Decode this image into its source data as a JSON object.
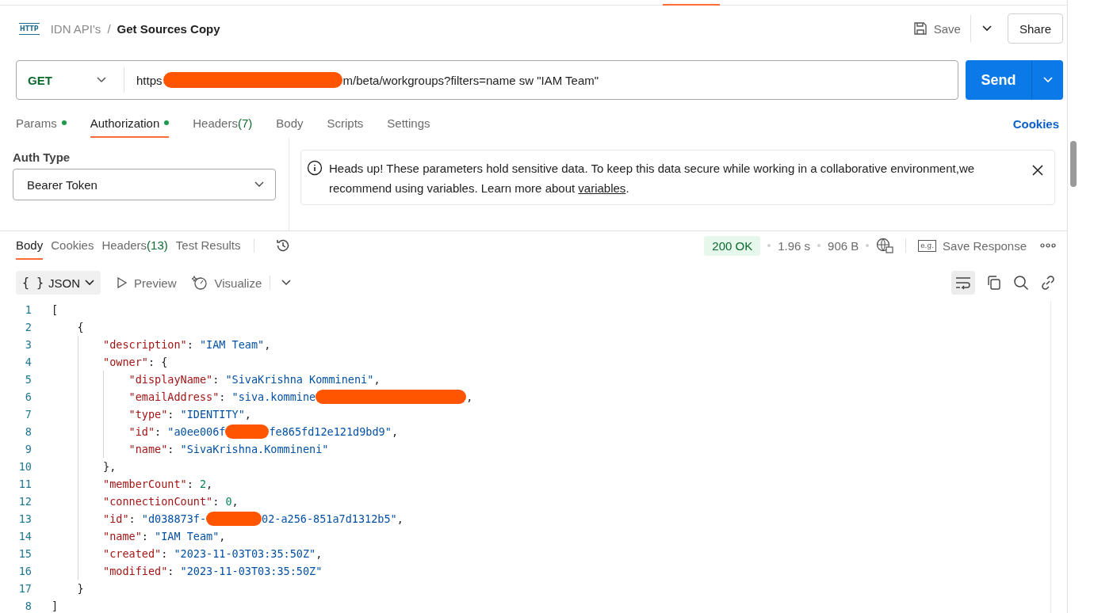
{
  "breadcrumb": {
    "icon_text": "HTTP",
    "collection": "IDN API's",
    "separator": "/",
    "request": "Get Sources Copy"
  },
  "actions": {
    "save": "Save",
    "share": "Share"
  },
  "request": {
    "method": "GET",
    "url_parts": [
      {
        "kind": "text",
        "text": "https"
      },
      {
        "kind": "redaction"
      },
      {
        "kind": "text",
        "text": "m/beta/workgroups?filters=name sw \"IAM Team\""
      }
    ],
    "send": "Send"
  },
  "request_tabs": [
    {
      "label": "Params",
      "dot": true,
      "selected": false
    },
    {
      "label": "Authorization",
      "dot": true,
      "selected": true
    },
    {
      "label": "Headers",
      "count": "(7)",
      "dot": false,
      "selected": false
    },
    {
      "label": "Body",
      "dot": false,
      "selected": false
    },
    {
      "label": "Scripts",
      "dot": false,
      "selected": false
    },
    {
      "label": "Settings",
      "dot": false,
      "selected": false
    }
  ],
  "cookies_link": "Cookies",
  "auth": {
    "label": "Auth Type",
    "type": "Bearer Token"
  },
  "notice": {
    "text": "Heads up! These parameters hold sensitive data. To keep this data secure while working in a collaborative environment,we recommend using variables. Learn more about",
    "link": "variables",
    "end": "."
  },
  "response_tabs": [
    {
      "label": "Body",
      "selected": true
    },
    {
      "label": "Cookies",
      "selected": false
    },
    {
      "label": "Headers",
      "count": "(13)",
      "selected": false
    },
    {
      "label": "Test Results",
      "selected": false
    }
  ],
  "status": {
    "code": "200 OK",
    "time": "1.96 s",
    "size": "906 B",
    "example_icon_text": "e.g.",
    "save_response": "Save Response"
  },
  "format": {
    "braces": "{ }",
    "label": "JSON",
    "preview": "Preview",
    "visualize": "Visualize"
  },
  "code_lines": [
    {
      "number": "1",
      "tokens": [
        {
          "kind": "punct",
          "text": "["
        }
      ]
    },
    {
      "number": "2",
      "tokens": [
        {
          "kind": "punct",
          "text": "    {"
        }
      ]
    },
    {
      "number": "3",
      "tokens": [
        {
          "kind": "key",
          "text": "        \"description\""
        },
        {
          "kind": "punct",
          "text": ": "
        },
        {
          "kind": "string",
          "text": "\"IAM Team\""
        },
        {
          "kind": "punct",
          "text": ","
        }
      ]
    },
    {
      "number": "4",
      "tokens": [
        {
          "kind": "key",
          "text": "        \"owner\""
        },
        {
          "kind": "punct",
          "text": ": {"
        }
      ]
    },
    {
      "number": "5",
      "tokens": [
        {
          "kind": "key",
          "text": "            \"displayName\""
        },
        {
          "kind": "punct",
          "text": ": "
        },
        {
          "kind": "string",
          "text": "\"SivaKrishna Kommineni\""
        },
        {
          "kind": "punct",
          "text": ","
        }
      ]
    },
    {
      "number": "6",
      "tokens": [
        {
          "kind": "key",
          "text": "            \"emailAddress\""
        },
        {
          "kind": "punct",
          "text": ": "
        },
        {
          "kind": "string",
          "text": "\"siva.kommine"
        },
        {
          "kind": "redaction"
        },
        {
          "kind": "punct",
          "text": ","
        }
      ]
    },
    {
      "number": "7",
      "tokens": [
        {
          "kind": "key",
          "text": "            \"type\""
        },
        {
          "kind": "punct",
          "text": ": "
        },
        {
          "kind": "string",
          "text": "\"IDENTITY\""
        },
        {
          "kind": "punct",
          "text": ","
        }
      ]
    },
    {
      "number": "8",
      "tokens": [
        {
          "kind": "key",
          "text": "            \"id\""
        },
        {
          "kind": "punct",
          "text": ": "
        },
        {
          "kind": "string",
          "text": "\"a0ee006f"
        },
        {
          "kind": "redaction"
        },
        {
          "kind": "string",
          "text": "fe865fd12e121d9bd9\""
        },
        {
          "kind": "punct",
          "text": ","
        }
      ]
    },
    {
      "number": "9",
      "tokens": [
        {
          "kind": "key",
          "text": "            \"name\""
        },
        {
          "kind": "punct",
          "text": ": "
        },
        {
          "kind": "string",
          "text": "\"SivaKrishna.Kommineni\""
        }
      ]
    },
    {
      "number": "10",
      "tokens": [
        {
          "kind": "punct",
          "text": "        },"
        }
      ]
    },
    {
      "number": "11",
      "tokens": [
        {
          "kind": "key",
          "text": "        \"memberCount\""
        },
        {
          "kind": "punct",
          "text": ": "
        },
        {
          "kind": "number",
          "text": "2"
        },
        {
          "kind": "punct",
          "text": ","
        }
      ]
    },
    {
      "number": "12",
      "tokens": [
        {
          "kind": "key",
          "text": "        \"connectionCount\""
        },
        {
          "kind": "punct",
          "text": ": "
        },
        {
          "kind": "number",
          "text": "0"
        },
        {
          "kind": "punct",
          "text": ","
        }
      ]
    },
    {
      "number": "13",
      "tokens": [
        {
          "kind": "key",
          "text": "        \"id\""
        },
        {
          "kind": "punct",
          "text": ": "
        },
        {
          "kind": "string",
          "text": "\"d038873f-"
        },
        {
          "kind": "redaction"
        },
        {
          "kind": "string",
          "text": "02-a256-851a7d1312b5\""
        },
        {
          "kind": "punct",
          "text": ","
        }
      ]
    },
    {
      "number": "14",
      "tokens": [
        {
          "kind": "key",
          "text": "        \"name\""
        },
        {
          "kind": "punct",
          "text": ": "
        },
        {
          "kind": "string",
          "text": "\"IAM Team\""
        },
        {
          "kind": "punct",
          "text": ","
        }
      ]
    },
    {
      "number": "15",
      "tokens": [
        {
          "kind": "key",
          "text": "        \"created\""
        },
        {
          "kind": "punct",
          "text": ": "
        },
        {
          "kind": "string",
          "text": "\"2023-11-03T03:35:50Z\""
        },
        {
          "kind": "punct",
          "text": ","
        }
      ]
    },
    {
      "number": "16",
      "tokens": [
        {
          "kind": "key",
          "text": "        \"modified\""
        },
        {
          "kind": "punct",
          "text": ": "
        },
        {
          "kind": "string",
          "text": "\"2023-11-03T03:35:50Z\""
        }
      ]
    },
    {
      "number": "17",
      "tokens": [
        {
          "kind": "punct",
          "text": "    }"
        }
      ]
    },
    {
      "number": "8",
      "tokens": [
        {
          "kind": "punct",
          "text": "]"
        }
      ]
    }
  ]
}
